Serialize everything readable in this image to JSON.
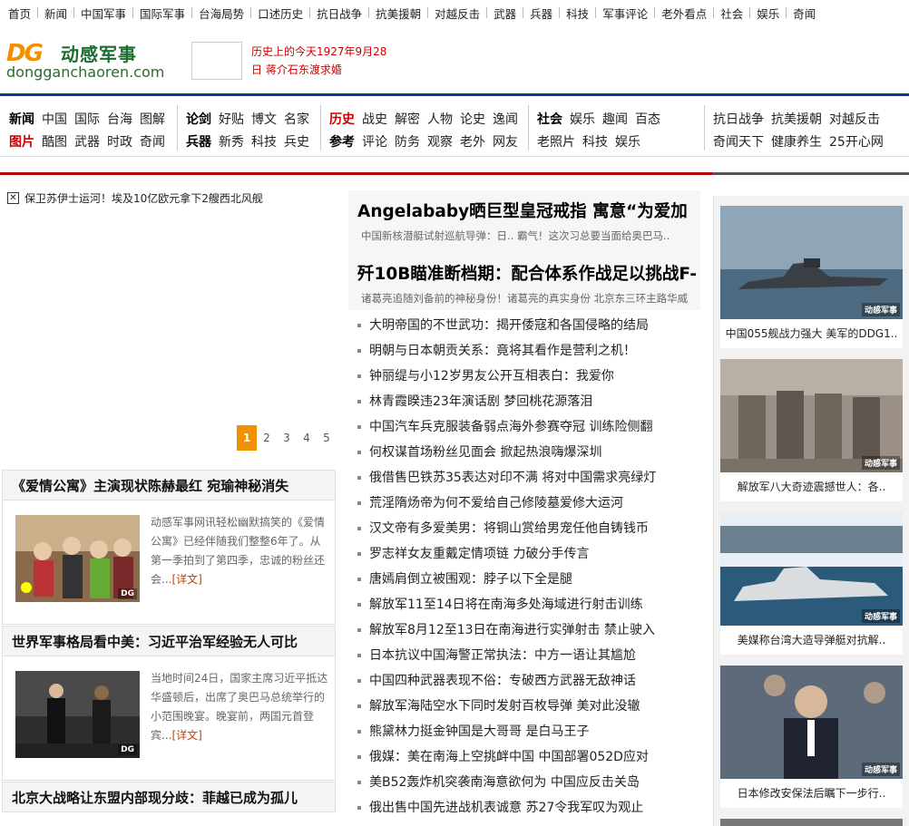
{
  "topnav": [
    "首页",
    "新闻",
    "中国军事",
    "国际军事",
    "台海局势",
    "口述历史",
    "抗日战争",
    "抗美援朝",
    "对越反击",
    "武器",
    "兵器",
    "科技",
    "军事评论",
    "老外看点",
    "社会",
    "娱乐",
    "奇闻"
  ],
  "logo": {
    "mark": "DG",
    "brand": "动感军事",
    "url": "dongganchaoren.com"
  },
  "today": {
    "line1": "历史上的今天1927年9月28",
    "line2": "日  蒋介石东渡求婚"
  },
  "channels": {
    "g1": {
      "r1": [
        "新闻",
        "中国",
        "国际",
        "台海",
        "图解"
      ],
      "r2": [
        "图片",
        "酷图",
        "武器",
        "时政",
        "奇闻"
      ]
    },
    "g2": {
      "r1": [
        "论剑",
        "好贴",
        "博文",
        "名家"
      ],
      "r2": [
        "兵器",
        "新秀",
        "科技",
        "兵史"
      ]
    },
    "g3": {
      "r1": [
        "历史",
        "战史",
        "解密",
        "人物",
        "论史",
        "逸闻"
      ],
      "r2": [
        "参考",
        "评论",
        "防务",
        "观察",
        "老外",
        "网友"
      ]
    },
    "g4": {
      "r1": [
        "社会",
        "娱乐",
        "趣闻",
        "百态"
      ],
      "r2": [
        "老照片",
        "科技",
        "娱乐"
      ]
    },
    "g5": {
      "r1": [
        "抗日战争",
        "抗美援朝",
        "对越反击"
      ],
      "r2": [
        "奇闻天下",
        "健康养生",
        "25开心网"
      ]
    }
  },
  "headline": {
    "icon": "close-box-icon",
    "text": "保卫苏伊士运河！埃及10亿欧元拿下2艘西北风舰"
  },
  "pager": [
    "1",
    "2",
    "3",
    "4",
    "5"
  ],
  "stories": [
    {
      "title": "《爱情公寓》主演现状陈赫最红 宛瑜神秘消失",
      "text": "动感军事网讯轻松幽默搞笑的《爱情公寓》已经伴随我们整整6年了。从第一季拍到了第四季，忠诚的粉丝还会...",
      "more": "[详文]"
    },
    {
      "title": "世界军事格局看中美：习近平治军经验无人可比",
      "text": "当地时间24日，国家主席习近平抵达华盛顿后，出席了奥巴马总统举行的小范围晚宴。晚宴前，两国元首登宾...",
      "more": "[详文]"
    },
    {
      "title": "北京大战略让东盟内部现分歧：菲越已成为孤儿"
    }
  ],
  "mid": {
    "big1": "Angelababy晒巨型皇冠戒指 寓意“为爱加",
    "sub1": "中国新核潜艇试射巡航导弹：日..  霸气！这次习总要当面给奥巴马..",
    "big2": "歼10B瞄准断档期：配合体系作战足以挑战F-",
    "sub2": "诸葛亮追随刘备前的神秘身份！诸葛亮的真实身份  北京东三环主路华威"
  },
  "news": [
    "大明帝国的不世武功：揭开倭寇和各国侵略的结局",
    "明朝与日本朝贡关系：竟将其看作是营利之机！",
    "钟丽缇与小12岁男友公开互相表白：我爱你",
    "林青霞睽违23年演话剧 梦回桃花源落泪",
    "中国汽车兵克服装备弱点海外参赛夺冠 训练险侧翻",
    "何权谋首场粉丝见面会 掀起热浪嗨爆深圳",
    "俄借售巴铁苏35表达对印不满 将对中国需求亮绿灯",
    "荒淫隋炀帝为何不爱给自己修陵墓爱修大运河",
    "汉文帝有多爱美男：将铜山赏给男宠任他自铸钱币",
    "罗志祥女友重戴定情项链 力破分手传言",
    "唐嫣肩倒立被围观：脖子以下全是腿",
    "解放军11至14日将在南海多处海域进行射击训练",
    "解放军8月12至13日在南海进行实弹射击 禁止驶入",
    "日本抗议中国海警正常执法：中方一语让其尴尬",
    "中国四种武器表现不俗：专破西方武器无敌神话",
    "解放军海陆空水下同时发射百枚导弹 美对此没辙",
    "熊黛林力挺金钟国是大哥哥 是白马王子",
    "俄媒：美在南海上空挑衅中国 中国部署052D应对",
    "美B52轰炸机突袭南海意欲何为 中国应反击关岛",
    "俄出售中国先进战机表诚意 苏27令我军叹为观止"
  ],
  "right": [
    {
      "caption": "中国055舰战力强大 美军的DDG1..",
      "watermark": "动感军事"
    },
    {
      "caption": "解放军八大奇迹震撼世人：各..",
      "watermark": "动感军事"
    },
    {
      "caption": "美媒称台湾大造导弹艇对抗解..",
      "watermark": "动感军事"
    },
    {
      "caption": "日本修改安保法后瞩下一步行..",
      "watermark": "动感军事"
    }
  ]
}
